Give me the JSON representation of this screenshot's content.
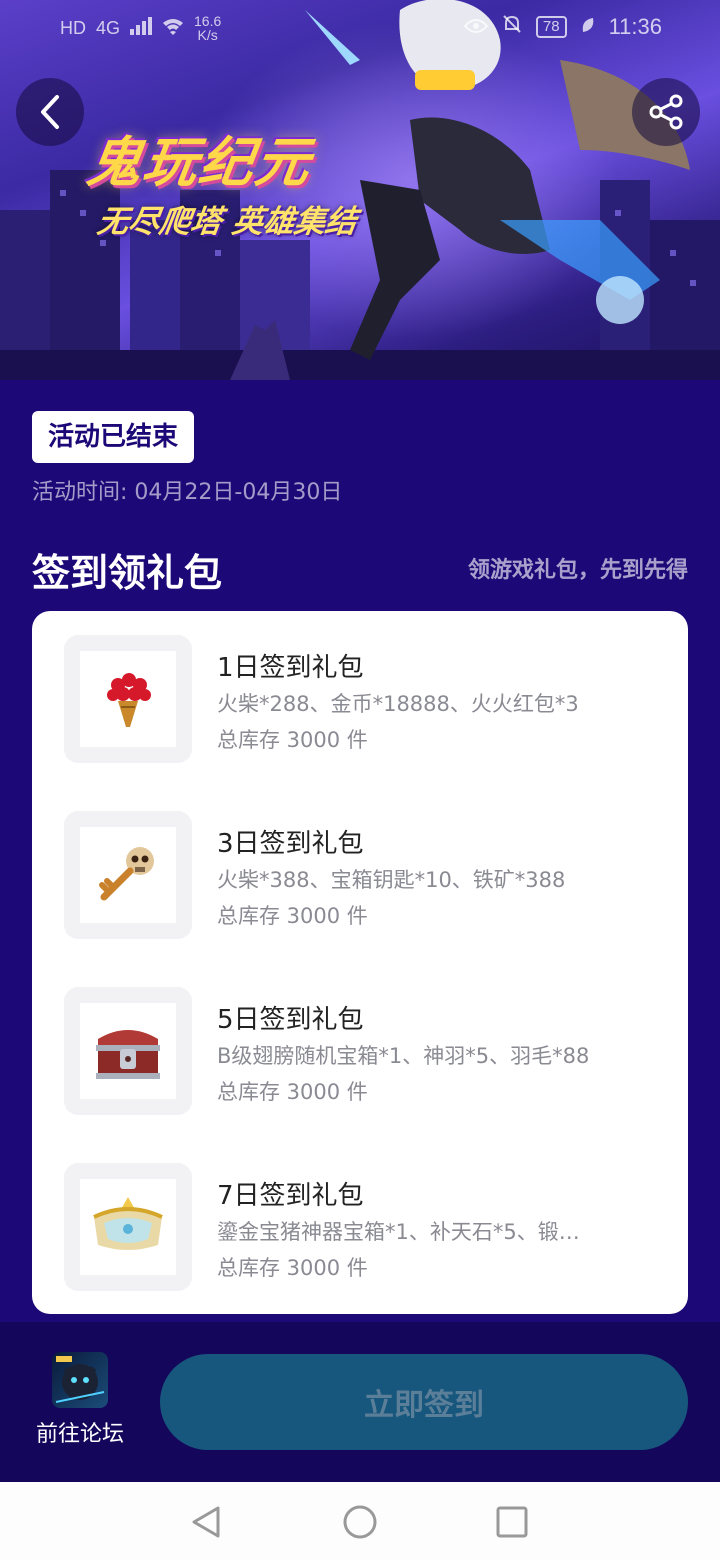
{
  "status_bar": {
    "net_left": "HD",
    "signal": "4G",
    "speed_value": "16.6",
    "speed_unit": "K/s",
    "battery": "78",
    "time": "11:36"
  },
  "banner": {
    "logo_main": "鬼玩纪元",
    "logo_sub": "无尽爬塔 英雄集结"
  },
  "activity": {
    "status_badge": "活动已结束",
    "period": "活动时间: 04月22日-04月30日"
  },
  "section": {
    "title": "签到领礼包",
    "hint": "领游戏礼包，先到先得"
  },
  "gifts": [
    {
      "name": "1日签到礼包",
      "desc": "火柴*288、金币*18888、火火红包*3",
      "stock": "总库存 3000 件",
      "icon": "flower-bouquet-icon"
    },
    {
      "name": "3日签到礼包",
      "desc": "火柴*388、宝箱钥匙*10、铁矿*388",
      "stock": "总库存 3000 件",
      "icon": "skull-key-icon"
    },
    {
      "name": "5日签到礼包",
      "desc": "B级翅膀随机宝箱*1、神羽*5、羽毛*88",
      "stock": "总库存 3000 件",
      "icon": "treasure-chest-icon"
    },
    {
      "name": "7日签到礼包",
      "desc": "鎏金宝猪神器宝箱*1、补天石*5、锻…",
      "stock": "总库存 3000 件",
      "icon": "golden-chest-icon"
    }
  ],
  "bottom": {
    "forum_label": "前往论坛",
    "signin_label": "立即签到"
  },
  "colors": {
    "page_bg": "#1d0877",
    "bottom_bar_bg": "#14065a",
    "signin_btn": "#17567d",
    "badge_text": "#1d0877"
  }
}
